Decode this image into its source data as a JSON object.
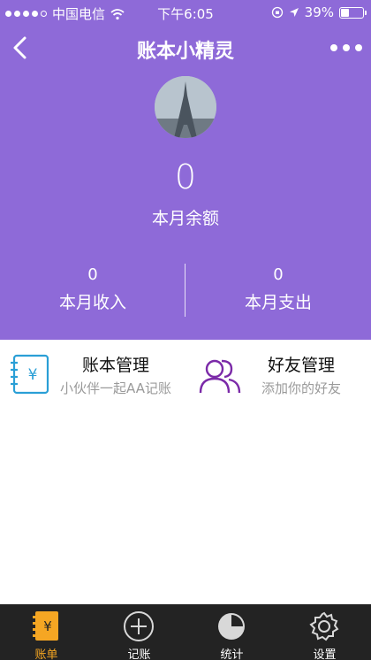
{
  "status_bar": {
    "carrier": "中国电信",
    "time": "下午6:05",
    "battery": "39%",
    "battery_level": 0.39
  },
  "nav": {
    "title": "账本小精灵"
  },
  "summary": {
    "balance_value": "0",
    "balance_label": "本月余额",
    "income_value": "0",
    "income_label": "本月收入",
    "expense_value": "0",
    "expense_label": "本月支出"
  },
  "cards": [
    {
      "title": "账本管理",
      "subtitle": "小伙伴一起AA记账"
    },
    {
      "title": "好友管理",
      "subtitle": "添加你的好友"
    }
  ],
  "tabs": [
    {
      "label": "账单"
    },
    {
      "label": "记账"
    },
    {
      "label": "统计"
    },
    {
      "label": "设置"
    }
  ],
  "colors": {
    "header_bg": "#8e6ad8",
    "tab_active": "#f5a623",
    "ledger_icon": "#2a9fd6",
    "friends_icon": "#7b2aa8",
    "tabbar_bg": "#232323"
  },
  "icons": {
    "back": "chevron-left-icon",
    "more": "more-dots-icon",
    "ledger": "ledger-book-icon",
    "friends": "friends-icon",
    "bills": "bills-icon",
    "add": "plus-circle-icon",
    "stats": "pie-chart-icon",
    "settings": "gear-icon"
  }
}
